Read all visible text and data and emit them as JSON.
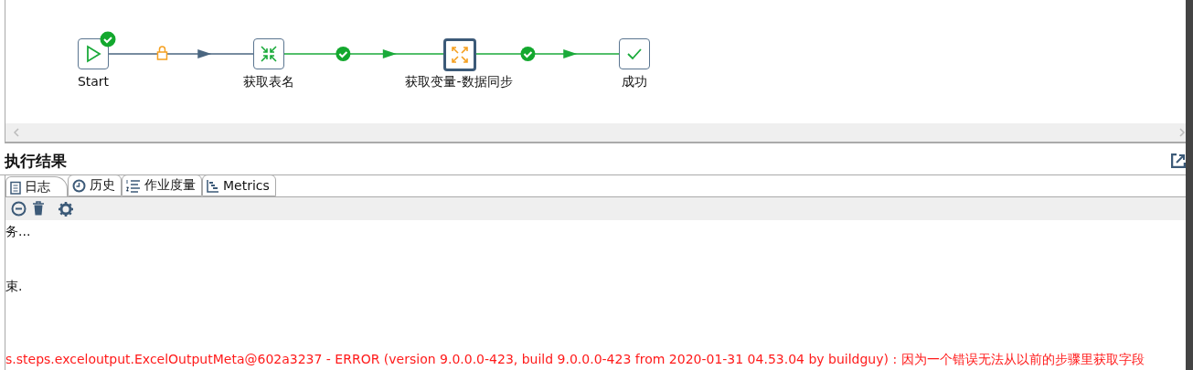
{
  "canvas": {
    "nodes": [
      {
        "label": "Start",
        "kind": "start",
        "selected": false,
        "finished": true
      },
      {
        "label": "获取表名",
        "kind": "collapse",
        "selected": false,
        "finished": false
      },
      {
        "label": "获取变量-数据同步",
        "kind": "expand",
        "selected": true,
        "finished": false
      },
      {
        "label": "成功",
        "kind": "success",
        "selected": false,
        "finished": false
      }
    ],
    "hops": [
      {
        "kind": "unconditional"
      },
      {
        "kind": "success"
      },
      {
        "kind": "success"
      }
    ]
  },
  "results": {
    "title": "执行结果",
    "tabs": [
      {
        "label": "日志",
        "kind": "log",
        "selected": true
      },
      {
        "label": "历史",
        "kind": "history",
        "selected": false
      },
      {
        "label": "作业度量",
        "kind": "metrics",
        "selected": false
      },
      {
        "label": "Metrics",
        "kind": "gantt",
        "selected": false
      }
    ],
    "log_lines": [
      {
        "text": "务...",
        "error": false
      },
      {
        "text": "束.",
        "error": false
      },
      {
        "text": "s.steps.exceloutput.ExcelOutputMeta@602a3237 - ERROR (version 9.0.0.0-423, build 9.0.0.0-423 from 2020-01-31 04.53.04 by buildguy) : 因为一个错误无法从以前的步骤里获取字段",
        "error": true
      }
    ]
  }
}
